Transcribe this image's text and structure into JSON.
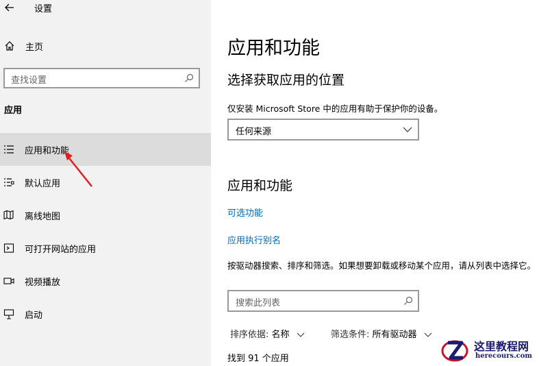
{
  "window": {
    "title": "设置"
  },
  "sidebar": {
    "home_label": "主页",
    "search_placeholder": "查找设置",
    "section_heading": "应用",
    "items": [
      {
        "label": "应用和功能",
        "icon": "apps-features-icon",
        "active": true
      },
      {
        "label": "默认应用",
        "icon": "default-apps-icon",
        "active": false
      },
      {
        "label": "离线地图",
        "icon": "offline-maps-icon",
        "active": false
      },
      {
        "label": "可打开网站的应用",
        "icon": "apps-for-websites-icon",
        "active": false
      },
      {
        "label": "视频播放",
        "icon": "video-playback-icon",
        "active": false
      },
      {
        "label": "启动",
        "icon": "startup-icon",
        "active": false
      }
    ]
  },
  "main": {
    "title": "应用和功能",
    "install_section": {
      "heading": "选择获取应用的位置",
      "description": "仅安装 Microsoft Store 中的应用有助于保护你的设备。",
      "dropdown_value": "任何来源"
    },
    "apps_section": {
      "heading": "应用和功能",
      "link_optional": "可选功能",
      "link_alias": "应用执行别名",
      "description": "按驱动器搜索、排序和筛选。如果想要卸载或移动某个应用，请从列表中选择它。",
      "search_placeholder": "搜索此列表",
      "sort_label": "排序依据:",
      "sort_value": "名称",
      "filter_label": "筛选条件:",
      "filter_value": "所有驱动器",
      "count_text": "找到 91 个应用"
    }
  },
  "watermark": {
    "text": "这里教程网",
    "url": "herecours.com"
  },
  "colors": {
    "link": "#0067b8",
    "sidebar_bg": "#f2f2f2",
    "active_bg": "#dcdcdc",
    "arrow": "#e02020"
  }
}
